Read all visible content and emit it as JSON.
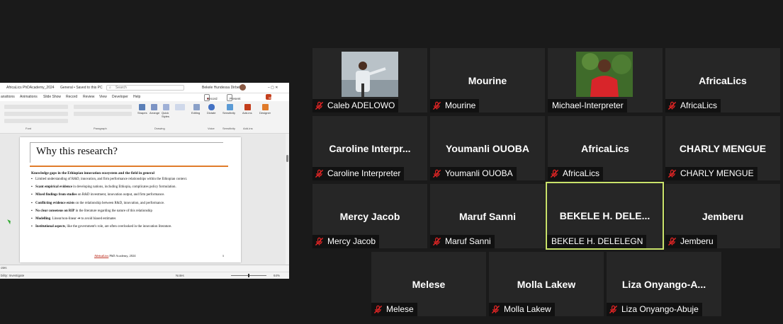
{
  "share": {
    "titlebar": {
      "file": "AfricaLics PhDAcademy_2024",
      "status": "General • Saved to this PC",
      "search": "Search",
      "user": "Bekele Hundessa Dirbelgn",
      "controls": "–   ▢   ✕"
    },
    "tabs": [
      "ansitions",
      "Animations",
      "Slide Show",
      "Record",
      "Review",
      "View",
      "Developer",
      "Help"
    ],
    "record_label": "Record",
    "teams_label": "Present in Teams",
    "share_label": "Share",
    "ribbon_groups": [
      "Font",
      "Paragraph",
      "Drawing",
      "Voice",
      "Sensitivity",
      "Add-ins"
    ],
    "ribbon_buttons": [
      "Shapes",
      "Arrange",
      "Quick Styles",
      "Editing",
      "Dictate",
      "Sensitivity",
      "Add-ins",
      "Designer"
    ],
    "slide": {
      "title": "Why this research?",
      "heading": "Knowledge gaps in the Ethiopian innovation ecosystem and the field in general",
      "bullets": [
        {
          "bold": "",
          "text": "Limited understanding of R&D, innovation, and firm performance relationships within the Ethiopian context."
        },
        {
          "bold": "Scant empirical evidence",
          "text": " in developing nations, including Ethiopia, complicates policy formulation."
        },
        {
          "bold": "Mixed findings from studies",
          "text": " on R&D investment, innovation output, and firm performance."
        },
        {
          "bold": "Conflicting evidence exists",
          "text": " on the relationship between R&D, innovation, and performance."
        },
        {
          "bold": "No clear consensus on RIP",
          "text": " in the literature regarding the nature of this relationship"
        },
        {
          "bold": "Modelling",
          "text": ". Linear/non-linear ➔ to avoid biased estimates"
        },
        {
          "bold": "Institutional aspects",
          "text": ", like the government's role, are often overlooked in the innovation literature."
        }
      ],
      "footer_brand": "AfricaLics",
      "footer_text": " PhD Academy, 2024",
      "number": "5"
    },
    "notes_label": "otes",
    "status_left": "bility: Investigate",
    "status_notes": "Notes",
    "zoom": "64%"
  },
  "participants": [
    {
      "display": "",
      "label": "Caleb ADELOWO",
      "photo": "speaker-photo"
    },
    {
      "display": "Mourine",
      "label": "Mourine"
    },
    {
      "display": "",
      "label": "Michael-Interpreter",
      "photo": "red-shirt-photo",
      "muted": false
    },
    {
      "display": "AfricaLics",
      "label": "AfricaLics"
    },
    {
      "display": "Caroline  Interpr...",
      "label": "Caroline Interpreter"
    },
    {
      "display": "Youmanli OUOBA",
      "label": "Youmanli OUOBA"
    },
    {
      "display": "AfricaLics",
      "label": "AfricaLics"
    },
    {
      "display": "CHARLY MENGUE",
      "label": "CHARLY MENGUE"
    },
    {
      "display": "Mercy Jacob",
      "label": "Mercy Jacob"
    },
    {
      "display": "Maruf Sanni",
      "label": "Maruf Sanni"
    },
    {
      "display": "BEKELE H. DELE...",
      "label": "BEKELE H. DELELEGN",
      "active": true,
      "muted": false
    },
    {
      "display": "Jemberu",
      "label": "Jemberu"
    },
    {
      "display": "Melese",
      "label": "Melese"
    },
    {
      "display": "Molla Lakew",
      "label": "Molla Lakew"
    },
    {
      "display": "Liza  Onyango-A...",
      "label": "Liza Onyango-Abuje"
    }
  ],
  "colors": {
    "background": "#1a1a1a",
    "tile": "#262626",
    "active_border": "#c9e26a",
    "mute_icon": "#e02424",
    "slide_accent": "#e07b2a"
  }
}
